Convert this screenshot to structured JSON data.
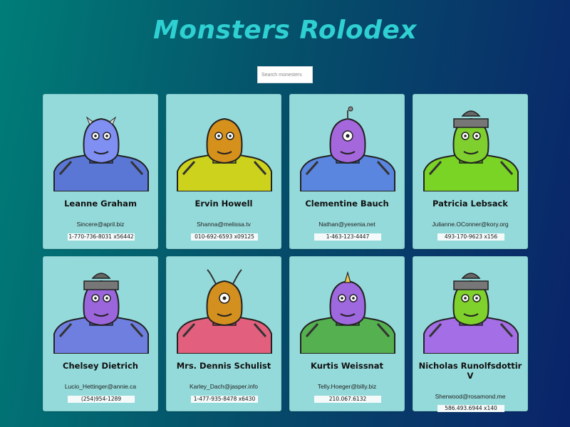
{
  "title": "Monsters Rolodex",
  "search": {
    "placeholder": "Search monesters",
    "value": ""
  },
  "monsters": [
    {
      "name": "Leanne Graham",
      "email": "Sincere@april.biz",
      "phone": "1-770-736-8031 x56442",
      "colors": {
        "skin": "#7f8ff2",
        "body": "#5a77d6",
        "accent": "#3b57b0"
      }
    },
    {
      "name": "Ervin Howell",
      "email": "Shanna@melissa.tv",
      "phone": "010-692-6593 x09125",
      "colors": {
        "skin": "#d6901c",
        "body": "#cdd21d",
        "accent": "#9aa514"
      }
    },
    {
      "name": "Clementine Bauch",
      "email": "Nathan@yesenia.net",
      "phone": "1-463-123-4447",
      "colors": {
        "skin": "#a468dc",
        "body": "#5a86e0",
        "accent": "#3a5fb4"
      }
    },
    {
      "name": "Patricia Lebsack",
      "email": "Julianne.OConner@kory.org",
      "phone": "493-170-9623 x156",
      "colors": {
        "skin": "#7fcf2f",
        "body": "#7ad425",
        "accent": "#5aa518"
      }
    },
    {
      "name": "Chelsey Dietrich",
      "email": "Lucio_Hettinger@annie.ca",
      "phone": "(254)954-1289",
      "colors": {
        "skin": "#9b66dc",
        "body": "#6f7fe0",
        "accent": "#4a5bc0"
      }
    },
    {
      "name": "Mrs. Dennis Schulist",
      "email": "Karley_Dach@jasper.info",
      "phone": "1-477-935-8478 x6430",
      "colors": {
        "skin": "#d4901e",
        "body": "#e2607d",
        "accent": "#b33f5c"
      }
    },
    {
      "name": "Kurtis Weissnat",
      "email": "Telly.Hoeger@billy.biz",
      "phone": "210.067.6132",
      "colors": {
        "skin": "#9e68de",
        "body": "#55b04f",
        "accent": "#3a8636"
      }
    },
    {
      "name": "Nicholas Runolfsdottir V",
      "email": "Sherwood@rosamond.me",
      "phone": "586.493.6944 x140",
      "colors": {
        "skin": "#7fd12c",
        "body": "#a46ee6",
        "accent": "#7d4ec4"
      }
    }
  ]
}
